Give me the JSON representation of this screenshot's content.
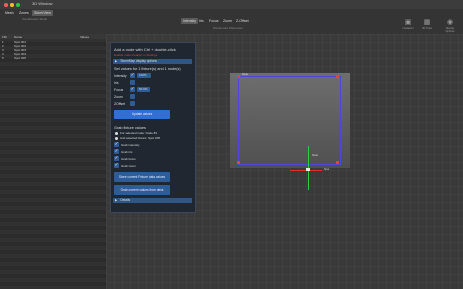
{
  "window": {
    "title": "3D Window"
  },
  "toolbar": {
    "left_buttons": [
      "Mesh",
      "Zones",
      "StormView"
    ],
    "left_sub": "Visualization Mode",
    "modes": [
      "Intensity",
      "Iris",
      "Focus",
      "Zoom",
      "Z-Offset"
    ],
    "modes_sub": "Showmode Parameter",
    "active_mode": "Intensity",
    "right_icons": [
      {
        "label": "Insulation",
        "icon": "camera-icon"
      },
      {
        "label": "3D Tools",
        "icon": "grid-icon"
      },
      {
        "label": "Display Options",
        "icon": "eye-icon"
      }
    ]
  },
  "sidebar": {
    "headers": [
      "FID",
      "Name",
      "Values"
    ],
    "rows": [
      {
        "fid": "1",
        "name": "Spot 001"
      },
      {
        "fid": "2",
        "name": "Spot 002"
      },
      {
        "fid": "3",
        "name": "Spot 003"
      },
      {
        "fid": "4",
        "name": "Spot 004"
      },
      {
        "fid": "5",
        "name": "Spot 005"
      }
    ]
  },
  "panel": {
    "add_node": "Add a node with Ctrl + double-click",
    "warning": "Enable node creation in Settings",
    "display_options": "StormMap display options",
    "set_values": "Set values for 1 fixture(s) and 1 node(s)",
    "fields": [
      {
        "label": "Intensity",
        "value": "100%"
      },
      {
        "label": "Iris",
        "value": ""
      },
      {
        "label": "Focus",
        "value": "50.0%"
      },
      {
        "label": "Zoom",
        "value": ""
      },
      {
        "label": "ZOffset",
        "value": ""
      }
    ],
    "update_button": "Update values",
    "grab_title": "Grab fixture values",
    "radio_selected_node": "For selected node: Node 83",
    "radio_selected_fixture": "And selected fixture: Spot 005",
    "grab_options": [
      "Grab intensity",
      "Grab iris",
      "Grab focus",
      "Grab zoom"
    ],
    "store_button": "Store current Fixture data values",
    "grab_button": "Grab current values from desk",
    "details": "Details"
  },
  "stage": {
    "corner_label": "Node",
    "center_label": "Node",
    "axis_label": "Spot"
  },
  "colors": {
    "accent": "#2f6fd6",
    "panel_bg": "#202730",
    "node_red": "#e04a2a",
    "axis_green": "#2ecc40",
    "axis_red": "#e03020"
  }
}
